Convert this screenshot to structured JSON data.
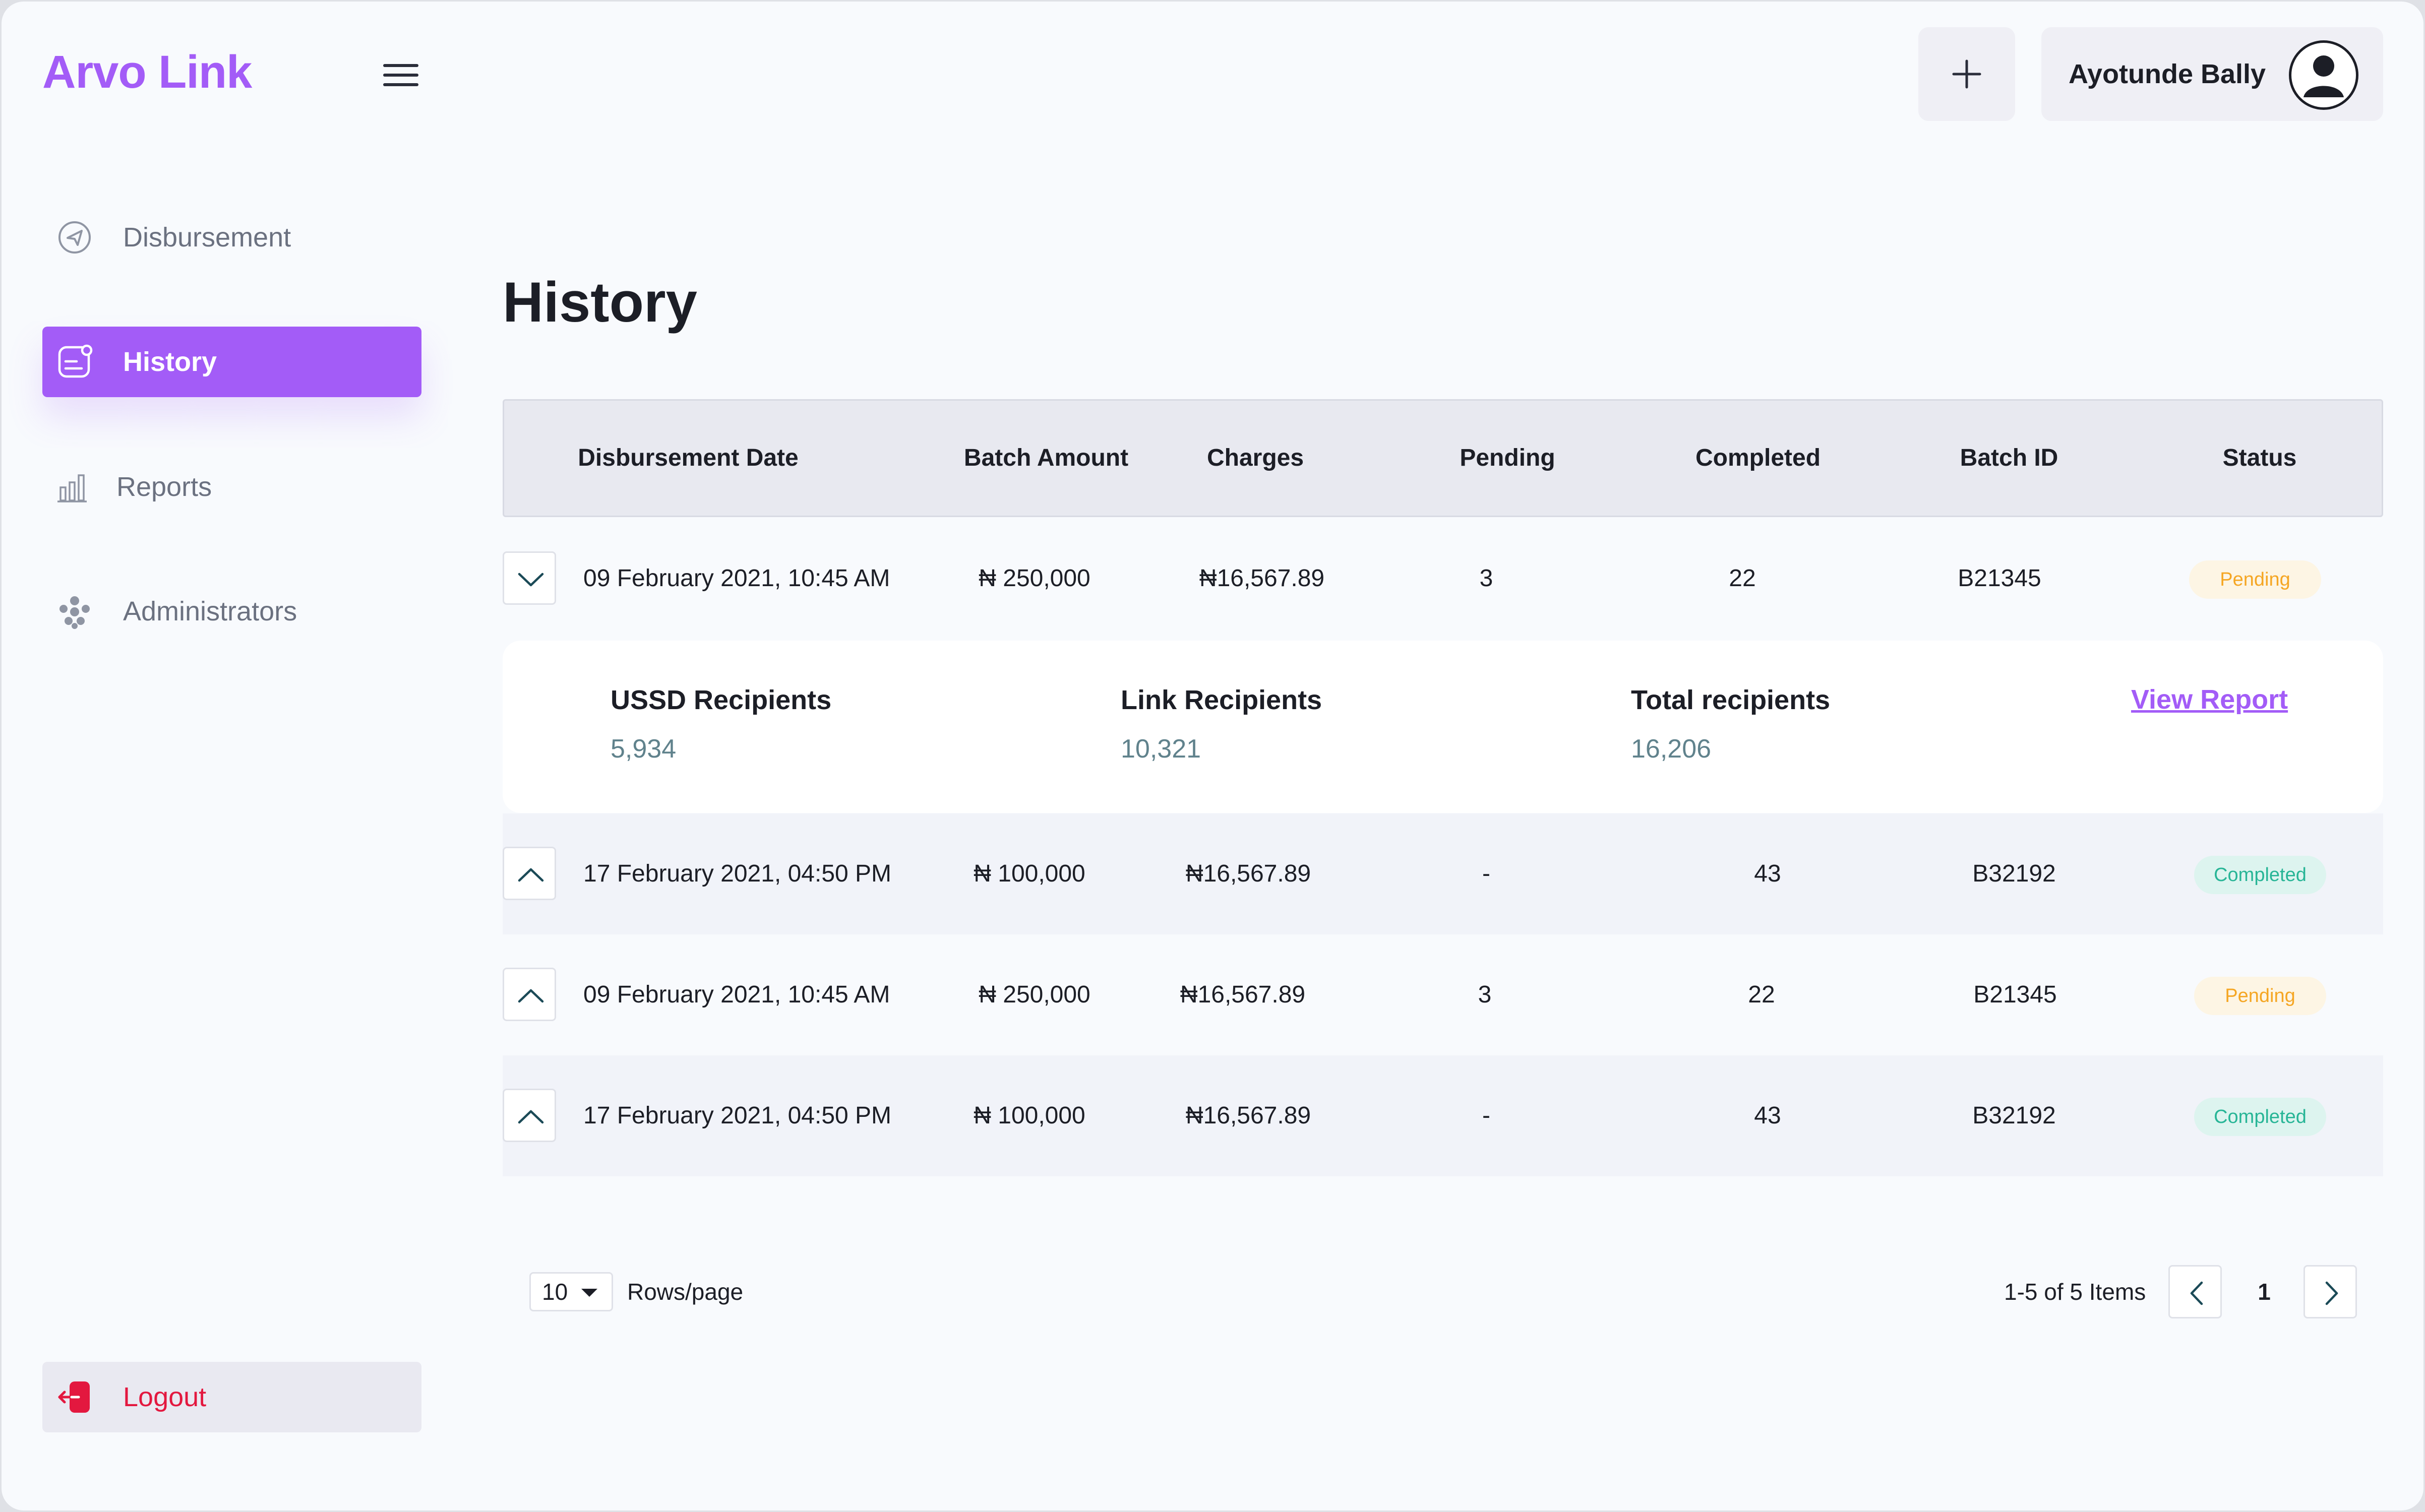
{
  "app": {
    "name": "Arvo Link"
  },
  "colors": {
    "brand": "#a35cf7",
    "pending": "#f5a623",
    "completed": "#27b596",
    "logout": "#e3183f"
  },
  "sidebar": {
    "items": [
      {
        "label": "Disbursement",
        "icon": "send-icon",
        "active": false
      },
      {
        "label": "History",
        "icon": "history-icon",
        "active": true
      },
      {
        "label": "Reports",
        "icon": "bar-chart-icon",
        "active": false
      },
      {
        "label": "Administrators",
        "icon": "users-icon",
        "active": false
      }
    ],
    "logout": {
      "label": "Logout",
      "icon": "logout-icon"
    }
  },
  "header": {
    "user_name": "Ayotunde Bally",
    "add_icon": "plus-icon",
    "avatar_icon": "user-icon"
  },
  "main": {
    "title": "History",
    "columns": [
      "Disbursement Date",
      "Batch Amount",
      "Charges",
      "Pending",
      "Completed",
      "Batch ID",
      "Status"
    ],
    "rows": [
      {
        "date": "09 February 2021, 10:45 AM",
        "amount": "₦ 250,000",
        "charges": "₦16,567.89",
        "pending": "3",
        "completed": "22",
        "batch_id": "B21345",
        "status": "Pending",
        "expanded": true
      },
      {
        "date": "17 February 2021, 04:50 PM",
        "amount": "₦ 100,000",
        "charges": "₦16,567.89",
        "pending": "-",
        "completed": "43",
        "batch_id": "B32192",
        "status": "Completed",
        "expanded": false
      },
      {
        "date": "09 February 2021, 10:45 AM",
        "amount": "₦ 250,000",
        "charges": "₦16,567.89",
        "pending": "3",
        "completed": "22",
        "batch_id": "B21345",
        "status": "Pending",
        "expanded": false
      },
      {
        "date": "17 February 2021, 04:50 PM",
        "amount": "₦ 100,000",
        "charges": "₦16,567.89",
        "pending": "-",
        "completed": "43",
        "batch_id": "B32192",
        "status": "Completed",
        "expanded": false
      }
    ],
    "detail": {
      "ussd_label": "USSD Recipients",
      "ussd_value": "5,934",
      "link_label": "Link Recipients",
      "link_value": "10,321",
      "total_label": "Total recipients",
      "total_value": "16,206",
      "view_report": "View Report"
    }
  },
  "pagination": {
    "rows_per_page": "10",
    "rows_label": "Rows/page",
    "items_info": "1-5 of 5 Items",
    "current_page": "1"
  }
}
